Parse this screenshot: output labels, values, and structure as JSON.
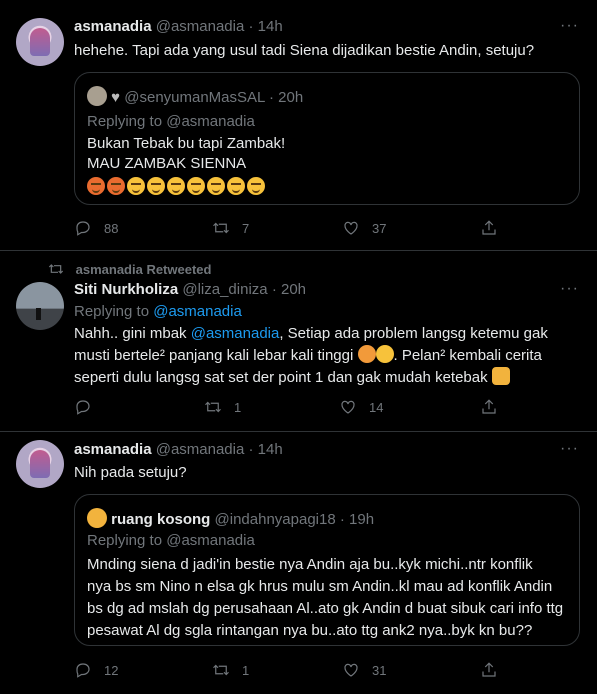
{
  "tweet1": {
    "name": "asmanadia",
    "handle": "@asmanadia",
    "sep": "·",
    "time": "14h",
    "text": "hehehe. Tapi ada yang usul tadi Siena dijadikan bestie Andin, setuju?",
    "quote": {
      "handle": "@senyumanMasSAL",
      "time": "20h",
      "replying_label": "Replying to",
      "replying_to": "@asmanadia",
      "line1": "Bukan Tebak bu tapi Zambak!",
      "line2": "MAU ZAMBAK SIENNA",
      "emojis": [
        "angry",
        "angry",
        "smile",
        "smile",
        "smile",
        "smile",
        "smile",
        "smile",
        "smile"
      ]
    },
    "replies": "88",
    "retweets": "7",
    "likes": "37"
  },
  "tweet2": {
    "retweeted_by": "asmanadia Retweeted",
    "name": "Siti Nurkholiza",
    "handle": "@liza_diniza",
    "sep": "·",
    "time": "20h",
    "replying_label": "Replying to",
    "replying_to": "@asmanadia",
    "line1_a": "Nahh.. gini mbak ",
    "line1_mention": "@asmanadia",
    "line1_b": ", Setiap ada problem langsg ketemu gak",
    "line2": "musti bertele² panjang kali lebar kali tinggi",
    "line2_b": ". Pelan² kembali cerita",
    "line3": "seperti dulu langsg sat set der point 1 dan gak mudah ketebak",
    "replies": "",
    "retweets": "1",
    "likes": "14"
  },
  "tweet3": {
    "name": "asmanadia",
    "handle": "@asmanadia",
    "sep": "·",
    "time": "14h",
    "text": "Nih pada setuju?",
    "quote": {
      "name": "ruang kosong",
      "handle": "@indahnyapagi18",
      "time": "19h",
      "replying_label": "Replying to",
      "replying_to": "@asmanadia",
      "line1": "Mnding siena d jadi'in bestie nya Andin aja bu..kyk michi..ntr konflik",
      "line2": "nya bs sm Nino n elsa gk hrus mulu sm Andin..kl mau ad konflik Andin",
      "line3": "bs dg ad mslah dg perusahaan Al..ato gk Andin d buat sibuk cari info ttg",
      "line4": "pesawat Al dg sgla rintangan nya bu..ato ttg ank2 nya..byk kn bu??"
    },
    "replies": "12",
    "retweets": "1",
    "likes": "31"
  },
  "more_label": "···",
  "colors": {
    "accent": "#1d9bf0",
    "muted": "#71767b",
    "text": "#e7e9ea",
    "border": "#2f3336"
  }
}
